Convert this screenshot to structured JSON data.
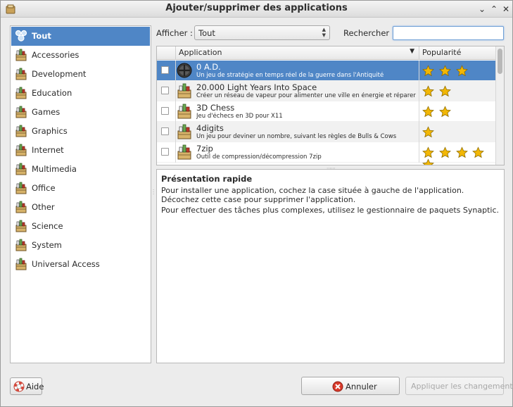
{
  "window": {
    "title": "Ajouter/supprimer des applications",
    "controls": [
      "⌄",
      "⌃",
      "✕"
    ]
  },
  "sidebar": {
    "items": [
      {
        "label": "Tout",
        "selected": true
      },
      {
        "label": "Accessories"
      },
      {
        "label": "Development"
      },
      {
        "label": "Education"
      },
      {
        "label": "Games"
      },
      {
        "label": "Graphics"
      },
      {
        "label": "Internet"
      },
      {
        "label": "Multimedia"
      },
      {
        "label": "Office"
      },
      {
        "label": "Other"
      },
      {
        "label": "Science"
      },
      {
        "label": "System"
      },
      {
        "label": "Universal Access"
      }
    ]
  },
  "filter": {
    "show_label": "Afficher :",
    "show_value": "Tout",
    "search_label": "Rechercher :",
    "search_value": ""
  },
  "table": {
    "columns": {
      "application": "Application",
      "popularity": "Popularité"
    },
    "rows": [
      {
        "name": "0 A.D.",
        "description": "Un jeu de stratégie en temps réel de la guerre dans l'Antiquité",
        "stars": 3,
        "selected": true,
        "icon": "0ad-icon"
      },
      {
        "name": "20.000 Light Years Into Space",
        "description": "Créer un réseau de vapeur pour alimenter une ville en énergie et réparer à temps les ...",
        "stars": 2,
        "icon": "package-icon"
      },
      {
        "name": "3D Chess",
        "description": "Jeu d'échecs en 3D pour X11",
        "stars": 2,
        "icon": "package-icon"
      },
      {
        "name": "4digits",
        "description": "Un jeu pour deviner un nombre, suivant les règles de Bulls & Cows",
        "stars": 1,
        "icon": "package-icon"
      },
      {
        "name": "7zip",
        "description": "Outil de compression/décompression 7zip",
        "stars": 5,
        "icon": "package-icon"
      }
    ]
  },
  "info": {
    "title": "Présentation rapide",
    "p1": "Pour installer une application, cochez la case située à gauche de l'application. Décochez cette case pour supprimer l'application.",
    "p2": "Pour effectuer des tâches plus complexes, utilisez le gestionnaire de paquets Synaptic."
  },
  "buttons": {
    "help": "Aide",
    "cancel": "Annuler",
    "apply": "Appliquer les changements"
  },
  "colors": {
    "selection": "#4f86c6",
    "star": "#f2b705"
  }
}
